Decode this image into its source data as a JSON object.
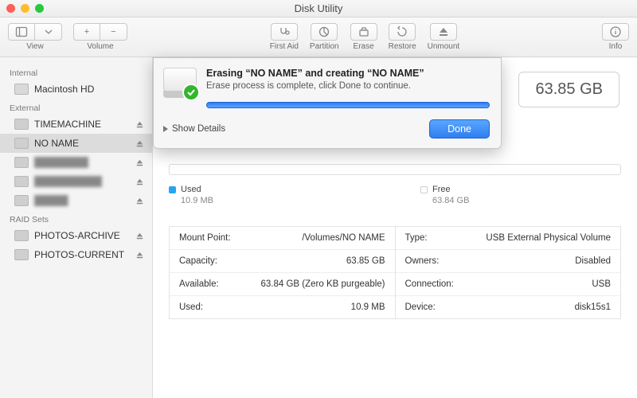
{
  "window": {
    "title": "Disk Utility"
  },
  "toolbar": {
    "view": "View",
    "volume": "Volume",
    "first_aid": "First Aid",
    "partition": "Partition",
    "erase": "Erase",
    "restore": "Restore",
    "unmount": "Unmount",
    "info": "Info"
  },
  "sidebar": {
    "sections": {
      "internal": "Internal",
      "external": "External",
      "raid": "RAID Sets"
    },
    "internal": [
      {
        "label": "Macintosh HD"
      }
    ],
    "external": [
      {
        "label": "TIMEMACHINE"
      },
      {
        "label": "NO NAME",
        "selected": true
      }
    ],
    "raid": [
      {
        "label": "PHOTOS-ARCHIVE"
      },
      {
        "label": "PHOTOS-CURRENT"
      }
    ]
  },
  "main": {
    "capacity_box": "63.85 GB",
    "usage": {
      "used_label": "Used",
      "used_value": "10.9 MB",
      "free_label": "Free",
      "free_value": "63.84 GB"
    },
    "info_left": [
      {
        "k": "Mount Point:",
        "v": "/Volumes/NO NAME"
      },
      {
        "k": "Capacity:",
        "v": "63.85 GB"
      },
      {
        "k": "Available:",
        "v": "63.84 GB (Zero KB purgeable)"
      },
      {
        "k": "Used:",
        "v": "10.9 MB"
      }
    ],
    "info_right": [
      {
        "k": "Type:",
        "v": "USB External Physical Volume"
      },
      {
        "k": "Owners:",
        "v": "Disabled"
      },
      {
        "k": "Connection:",
        "v": "USB"
      },
      {
        "k": "Device:",
        "v": "disk15s1"
      }
    ]
  },
  "sheet": {
    "title": "Erasing “NO NAME” and creating “NO NAME”",
    "subtitle": "Erase process is complete, click Done to continue.",
    "show_details": "Show Details",
    "done": "Done"
  }
}
